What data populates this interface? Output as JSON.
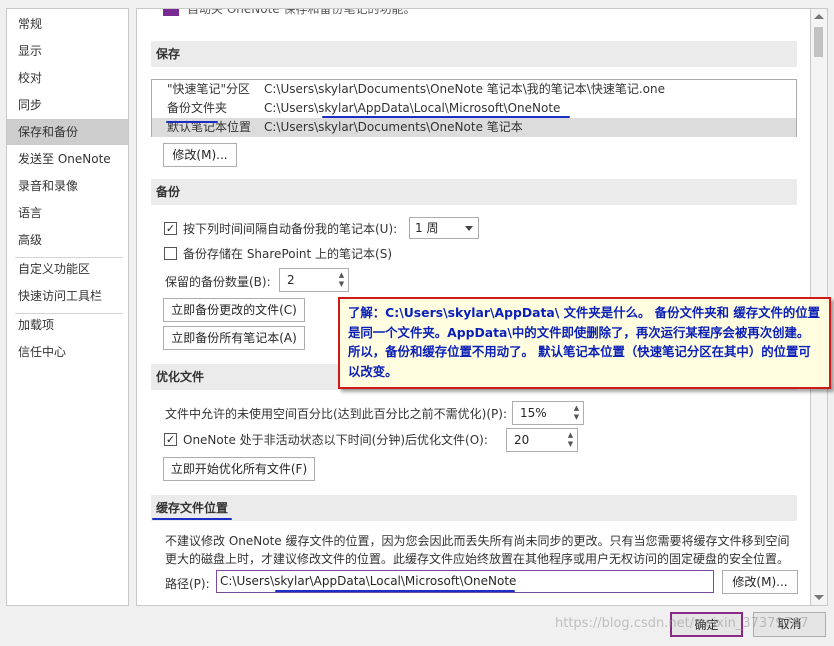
{
  "sidebar": {
    "items": [
      {
        "label": "常规"
      },
      {
        "label": "显示"
      },
      {
        "label": "校对"
      },
      {
        "label": "同步"
      },
      {
        "label": "保存和备份"
      },
      {
        "label": "发送至 OneNote"
      },
      {
        "label": "录音和录像"
      },
      {
        "label": "语言"
      },
      {
        "label": "高级"
      },
      {
        "label": "自定义功能区"
      },
      {
        "label": "快速访问工具栏"
      },
      {
        "label": "加载项"
      },
      {
        "label": "信任中心"
      }
    ],
    "selected": "保存和备份"
  },
  "top_cut_text": "自动关 OneNote 保存和备份笔记的功能。",
  "save": {
    "header": "保存",
    "locations": [
      {
        "key": "\"快速笔记\"分区",
        "value": "C:\\Users\\skylar\\Documents\\OneNote 笔记本\\我的笔记本\\快速笔记.one"
      },
      {
        "key": "备份文件夹",
        "value": "C:\\Users\\skylar\\AppData\\Local\\Microsoft\\OneNote"
      },
      {
        "key": "默认笔记本位置",
        "value": "C:\\Users\\skylar\\Documents\\OneNote 笔记本"
      }
    ],
    "modify_label": "修改(M)..."
  },
  "backup": {
    "header": "备份",
    "auto_backup_label": "按下列时间间隔自动备份我的笔记本(U):",
    "auto_backup_checked": true,
    "interval_value": "1 周",
    "sharepoint_label": "备份存储在 SharePoint 上的笔记本(S)",
    "sharepoint_checked": false,
    "keep_count_label": "保留的备份数量(B):",
    "keep_count_value": "2",
    "backup_changed_label": "立即备份更改的文件(C)",
    "backup_all_label": "立即备份所有笔记本(A)"
  },
  "optimize": {
    "header": "优化文件",
    "unused_space_label": "文件中允许的未使用空间百分比(达到此百分比之前不需优化)(P):",
    "unused_space_value": "15%",
    "inactive_label": "OneNote 处于非活动状态以下时间(分钟)后优化文件(O):",
    "inactive_checked": true,
    "inactive_value": "20",
    "optimize_all_label": "立即开始优化所有文件(F)"
  },
  "cache": {
    "header": "缓存文件位置",
    "description_line1": "不建议修改 OneNote 缓存文件的位置，因为您会因此而丢失所有尚未同步的更改。只有当您需要将缓存文件移到空间",
    "description_line2": "更大的磁盘上时，才建议修改文件的位置。此缓存文件应始终放置在其他程序或用户无权访问的固定硬盘的安全位置。",
    "path_label": "路径(P):",
    "path_value": "C:\\Users\\skylar\\AppData\\Local\\Microsoft\\OneNote",
    "modify_label": "修改(M)..."
  },
  "annotation": {
    "text": "了解：C:\\Users\\skylar\\AppData\\ 文件夹是什么。 备份文件夹和 缓存文件的位置是同一个文件夹。AppData\\中的文件即使删除了，再次运行某程序会被再次创建。所以，备份和缓存位置不用动了。 默认笔记本位置（快速笔记分区在其中）的位置可以改变。"
  },
  "footer": {
    "ok_label": "确定",
    "cancel_label": "取消"
  },
  "watermark": "https://blog.csdn.net/weixin_37379707",
  "colors": {
    "annotation_text": "#0a1fb8",
    "annotation_border": "#d01a1a",
    "annotation_bg": "#fffde0",
    "underline": "#1c2fc4"
  }
}
